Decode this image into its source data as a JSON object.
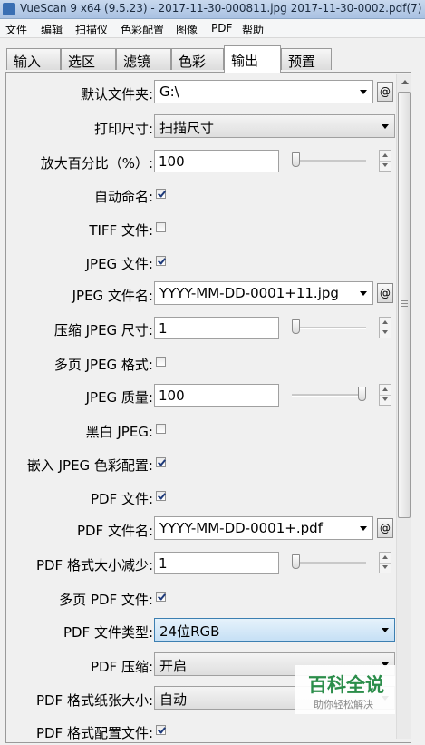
{
  "window": {
    "title": "VueScan 9 x64 (9.5.23) - 2017-11-30-000811.jpg 2017-11-30-0002.pdf(7)"
  },
  "menu": [
    "文件",
    "编辑",
    "扫描仪",
    "色彩配置",
    "图像",
    "PDF",
    "帮助"
  ],
  "tabs": [
    {
      "label": "输入",
      "active": false
    },
    {
      "label": "选区",
      "active": false
    },
    {
      "label": "滤镜",
      "active": false
    },
    {
      "label": "色彩",
      "active": false
    },
    {
      "label": "输出",
      "active": true
    },
    {
      "label": "预置",
      "active": false
    }
  ],
  "settings": {
    "default_folder": {
      "label": "默认文件夹:",
      "value": "G:\\",
      "button": "@"
    },
    "print_size": {
      "label": "打印尺寸:",
      "value": "扫描尺寸"
    },
    "magnify_percent": {
      "label": "放大百分比（%）:",
      "value": "100",
      "slider_fraction": 0.0
    },
    "auto_name": {
      "label": "自动命名:",
      "checked": true
    },
    "tiff_file": {
      "label": "TIFF 文件:",
      "checked": false
    },
    "jpeg_file": {
      "label": "JPEG 文件:",
      "checked": true
    },
    "jpeg_file_name": {
      "label": "JPEG 文件名:",
      "value": "YYYY-MM-DD-0001+11.jpg",
      "button": "@"
    },
    "jpeg_compress_size": {
      "label": "压缩 JPEG 尺寸:",
      "value": "1",
      "slider_fraction": 0.0
    },
    "multipage_jpeg": {
      "label": "多页 JPEG 格式:",
      "checked": false
    },
    "jpeg_quality": {
      "label": "JPEG 质量:",
      "value": "100",
      "slider_fraction": 1.0
    },
    "bw_jpeg": {
      "label": "黑白 JPEG:",
      "checked": false
    },
    "embed_jpeg_profile": {
      "label": "嵌入 JPEG 色彩配置:",
      "checked": true
    },
    "pdf_file": {
      "label": "PDF 文件:",
      "checked": true
    },
    "pdf_file_name": {
      "label": "PDF 文件名:",
      "value": "YYYY-MM-DD-0001+.pdf",
      "button": "@"
    },
    "pdf_size_reduce": {
      "label": "PDF 格式大小减少:",
      "value": "1",
      "slider_fraction": 0.0
    },
    "multipage_pdf": {
      "label": "多页 PDF 文件:",
      "checked": true
    },
    "pdf_file_type": {
      "label": "PDF 文件类型:",
      "value": "24位RGB"
    },
    "pdf_compress": {
      "label": "PDF 压缩:",
      "value": "开启"
    },
    "pdf_paper_size": {
      "label": "PDF 格式纸张大小:",
      "value": "自动"
    },
    "pdf_profile_file": {
      "label": "PDF 格式配置文件:",
      "checked": true
    }
  },
  "watermark": {
    "title": "百科全说",
    "subtitle": "助你轻松解决"
  }
}
